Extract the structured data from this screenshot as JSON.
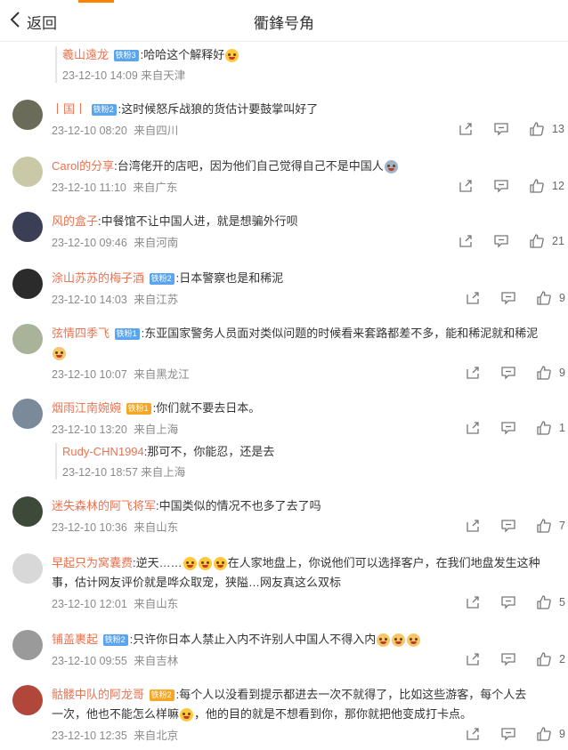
{
  "header": {
    "back_label": "返回",
    "title": "衢鋒号角"
  },
  "top_reply": {
    "user": "羲山遠龙",
    "badge": "铁粉3",
    "text": ":哈哈这个解释好",
    "time": "23-12-10 14:09",
    "source": "来自天津"
  },
  "comments": [
    {
      "user": "丨国丨",
      "badge": "铁粉2",
      "text": ":这时候怒斥战狼的货估计要鼓掌叫好了",
      "time": "23-12-10 08:20",
      "source": "来自四川",
      "likes": "13",
      "avatar_color": "#6b6b5a"
    },
    {
      "user": "Carol的分享",
      "text": ":台湾佬开的店吧，因为他们自己觉得自己不是中国人",
      "time": "23-12-10 11:10",
      "source": "来自广东",
      "likes": "12",
      "avatar_color": "#c9c9a8"
    },
    {
      "user": "风的盒子",
      "text": ":中餐馆不让中国人进，就是想骗外行呗",
      "time": "23-12-10 09:46",
      "source": "来自河南",
      "likes": "21",
      "avatar_color": "#3a3f55"
    },
    {
      "user": "涂山苏苏的梅子酒",
      "badge": "铁粉2",
      "text": ":日本警察也是和稀泥",
      "time": "23-12-10 14:03",
      "source": "来自江苏",
      "likes": "9",
      "avatar_color": "#2b2b2b"
    },
    {
      "user": "弦情四季飞",
      "badge": "铁粉1",
      "text": ":东亚国家警务人员面对类似问题的时候看来套路都差不多，能和稀泥就和稀泥",
      "time": "23-12-10 10:07",
      "source": "来自黑龙江",
      "likes": "9",
      "avatar_color": "#a9b39a"
    },
    {
      "user": "烟雨江南婉婉",
      "badge": "铁粉1",
      "text": ":你们就不要去日本。",
      "time": "23-12-10 13:20",
      "source": "来自上海",
      "likes": "1",
      "avatar_color": "#7a8a9a",
      "reply": {
        "user": "Rudy-CHN1994",
        "text": ":那可不，你能忍，还是去",
        "time": "23-12-10 18:57",
        "source": "来自上海"
      }
    },
    {
      "user": "迷失森林的阿飞将军",
      "text": ":中国类似的情况不也多了去了吗",
      "time": "23-12-10 10:36",
      "source": "来自山东",
      "likes": "7",
      "avatar_color": "#3d4a3a"
    },
    {
      "user": "早起只为窝囊费",
      "text": ":逆天……",
      "text2": "在人家地盘上，你说他们可以选择客户，在我们地盘发生这种",
      "text3": "事，估计网友评价就是哗众取宠，狭隘…网友真这么双标",
      "time": "23-12-10 12:01",
      "source": "来自山东",
      "likes": "5",
      "avatar_color": "#d8d8d8"
    },
    {
      "user": "铺盖裹起",
      "badge": "铁粉2",
      "text": ":只许你日本人禁止入内不许别人中国人不得入内",
      "time": "23-12-10 09:55",
      "source": "来自吉林",
      "likes": "2",
      "avatar_color": "#9a9a9a"
    },
    {
      "user": "骷髅中队的阿龙哥",
      "badge": "铁粉2",
      "text": ":每个人以没看到提示都进去一次不就得了，比如这些游客，每个人去",
      "text2": "一次，他也不能怎么样嘛",
      "text3": "，他的目的就是不想看到你，那你就把他变成打卡点。",
      "time": "23-12-10 12:35",
      "source": "来自北京",
      "likes": "9",
      "avatar_color": "#b0473a"
    }
  ],
  "icons": {
    "back": "chevron-left-icon",
    "share": "share-icon",
    "comment": "comment-icon",
    "like": "thumbs-up-icon"
  },
  "colors": {
    "accent": "#ff8200",
    "username": "#eb7350",
    "badge": "#5aa5ee"
  }
}
